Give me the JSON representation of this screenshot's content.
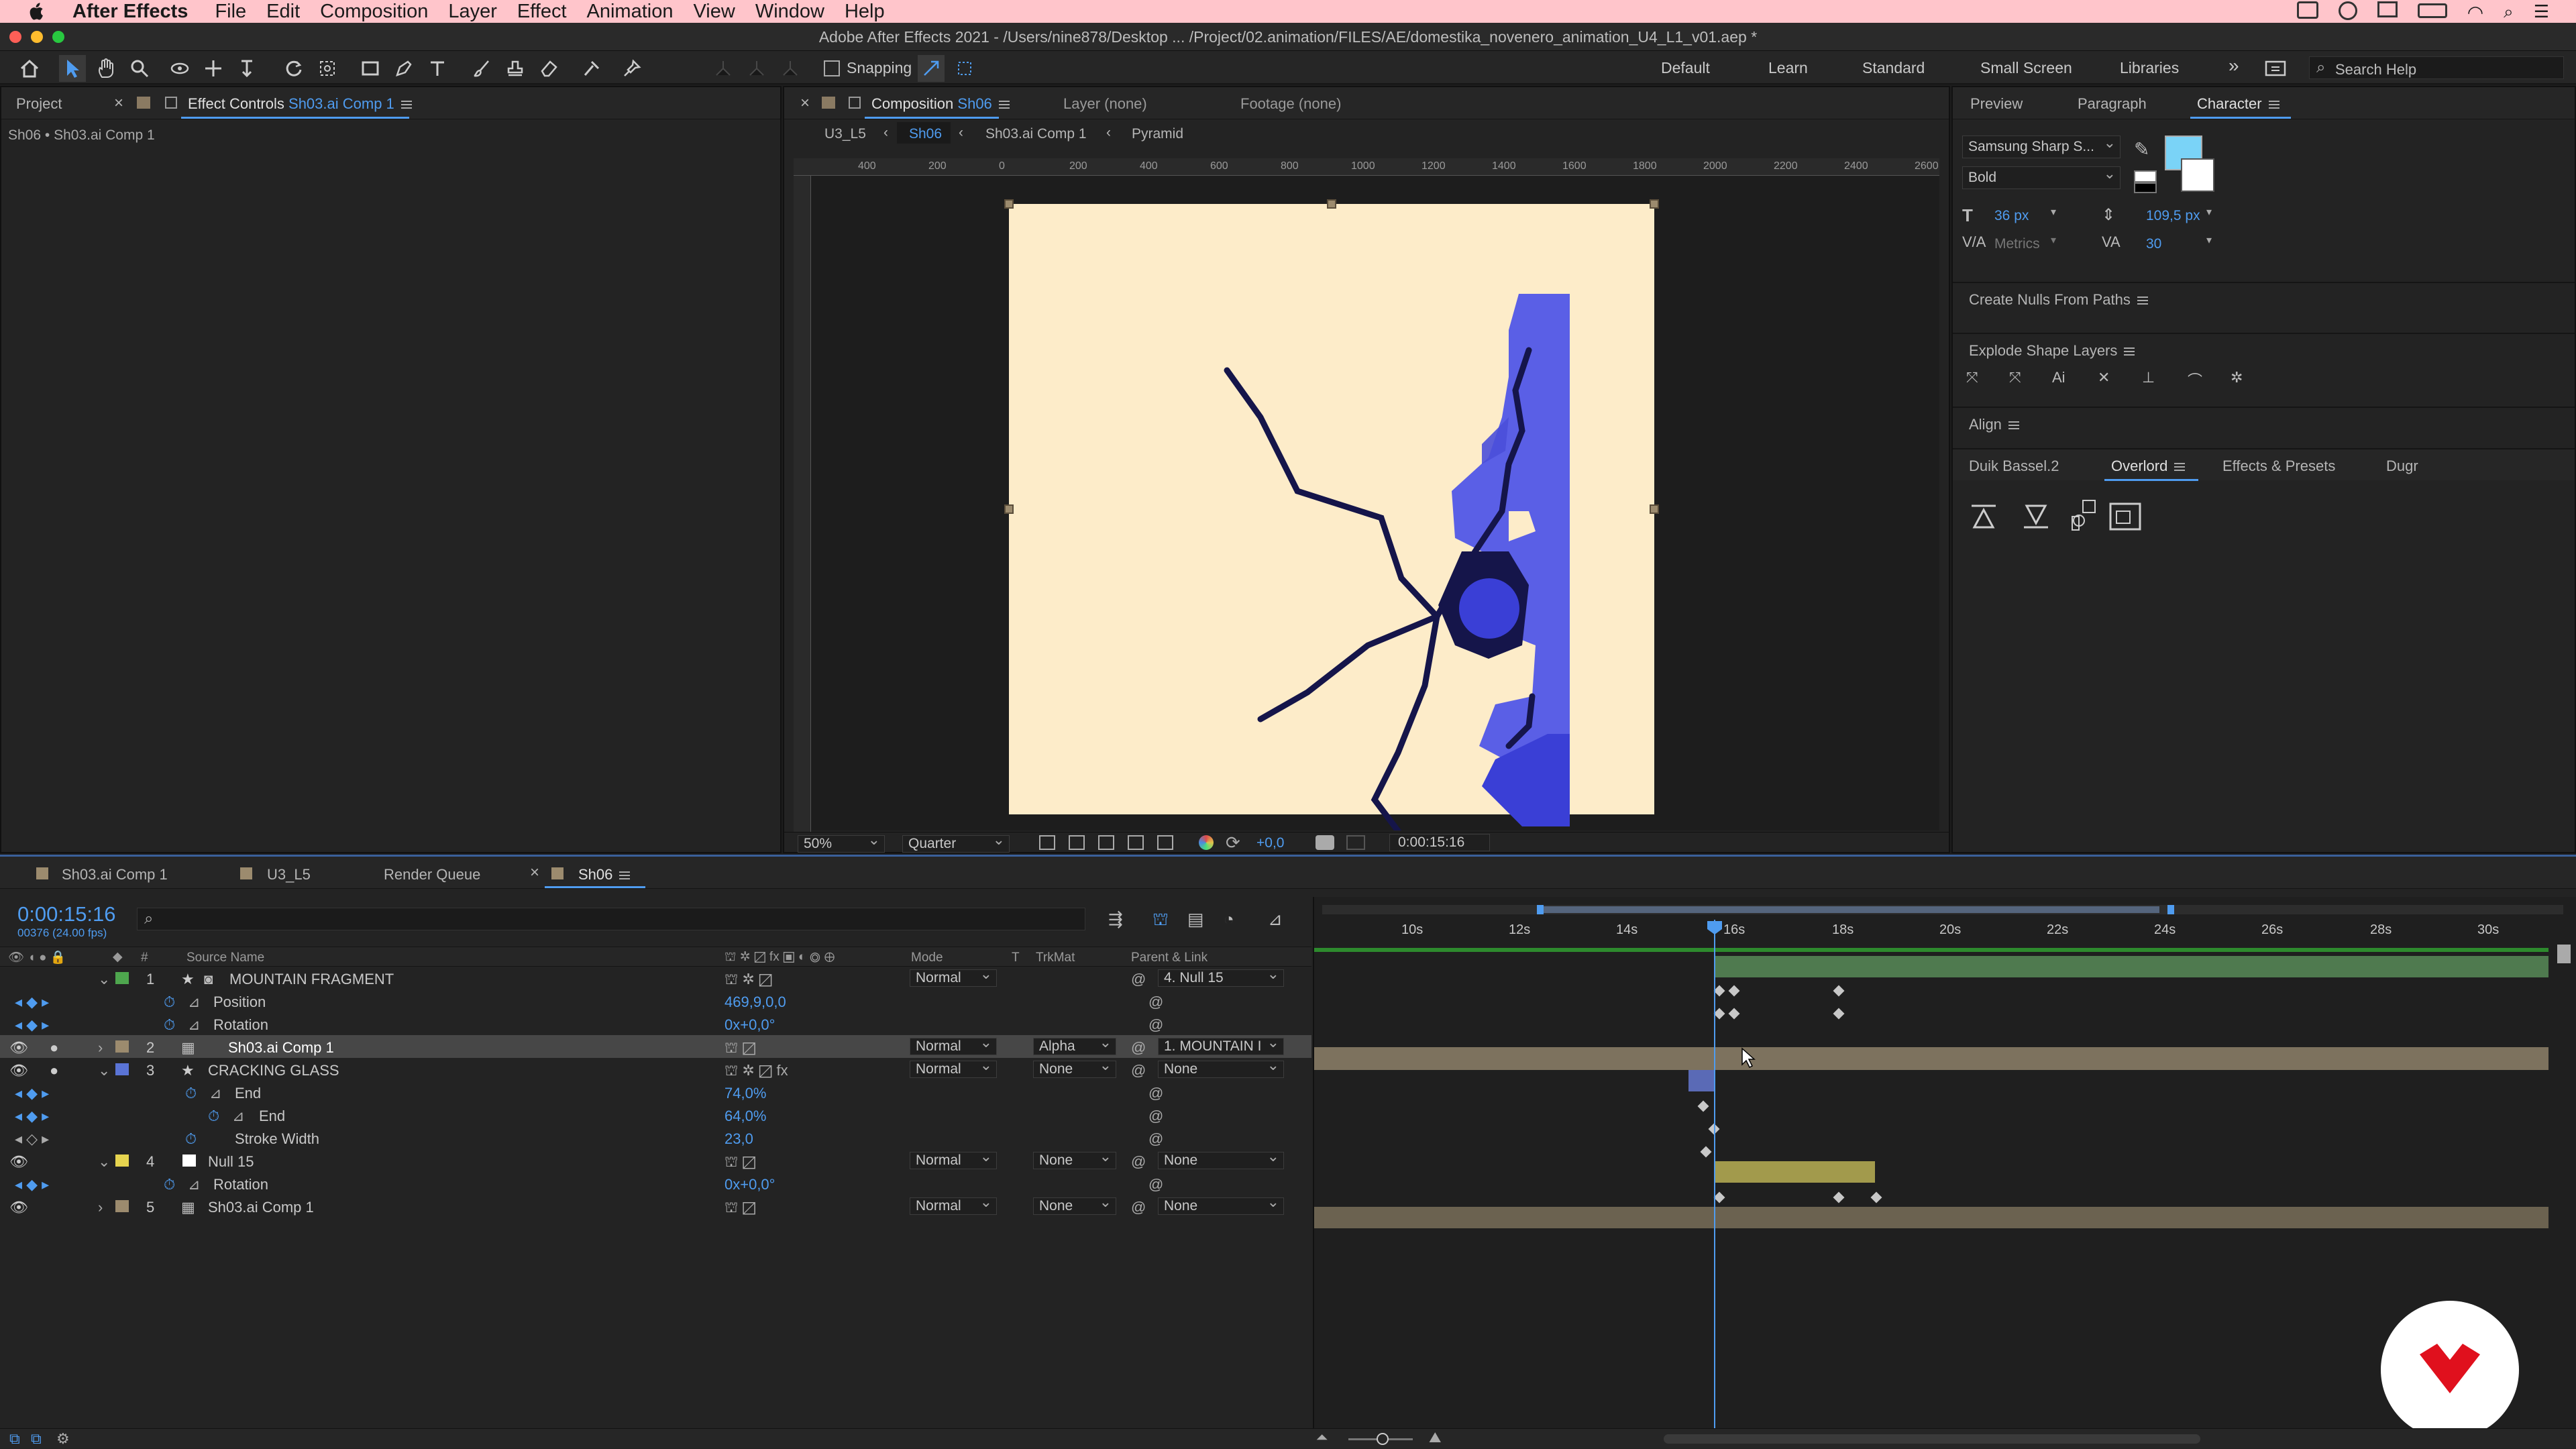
{
  "menubar": {
    "apple": "",
    "app_name": "After Effects",
    "menus": [
      "File",
      "Edit",
      "Composition",
      "Layer",
      "Effect",
      "Animation",
      "View",
      "Window",
      "Help"
    ]
  },
  "window": {
    "title": "Adobe After Effects 2021 - /Users/nine878/Desktop ... /Project/02.animation/FILES/AE/domestika_novenero_animation_U4_L1_v01.aep *"
  },
  "toolbar": {
    "snapping_label": "Snapping",
    "workspaces": [
      "Default",
      "Learn",
      "Standard",
      "Small Screen",
      "Libraries"
    ],
    "search_placeholder": "Search Help"
  },
  "left_panel": {
    "tab_project": "Project",
    "tab_effect_controls": "Effect Controls",
    "tab_effect_controls_target": "Sh03.ai Comp 1",
    "breadcrumb": "Sh06 • Sh03.ai Comp 1"
  },
  "comp_panel": {
    "tab_label": "Composition",
    "tab_comp_name": "Sh06",
    "tab_layer": "Layer (none)",
    "tab_footage": "Footage (none)",
    "nav": [
      "U3_L5",
      "Sh06",
      "Sh03.ai Comp 1",
      "Pyramid"
    ],
    "ruler_labels": [
      "400",
      "200",
      "0",
      "200",
      "400",
      "600",
      "800",
      "1000",
      "1200",
      "1400",
      "1600",
      "1800",
      "2000",
      "2200",
      "2400",
      "2600"
    ],
    "zoom": "50%",
    "resolution": "Quarter",
    "exposure": "+0,0",
    "timecode": "0:00:15:16"
  },
  "right_panel": {
    "tabs": [
      "Preview",
      "Paragraph",
      "Character"
    ],
    "font_family": "Samsung Sharp S...",
    "font_style": "Bold",
    "font_size": "36 px",
    "leading": "109,5 px",
    "kerning": "Metrics",
    "tracking": "30",
    "fill_color": "#7ad3f7",
    "scripts": [
      "Create Nulls From Paths",
      "Explode Shape Layers",
      "Align"
    ],
    "bottom_tabs": [
      "Duik Bassel.2",
      "Overlord",
      "Effects & Presets",
      "Dugr"
    ]
  },
  "timeline": {
    "tabs": [
      "Sh03.ai Comp 1",
      "U3_L5",
      "Render Queue",
      "Sh06"
    ],
    "timecode": "0:00:15:16",
    "frame_info": "00376 (24.00 fps)",
    "column_headers": {
      "num": "#",
      "source": "Source Name",
      "mode": "Mode",
      "t": "T",
      "trkmat": "TrkMat",
      "parent": "Parent & Link"
    },
    "ruler": [
      "10s",
      "12s",
      "14s",
      "16s",
      "18s",
      "20s",
      "22s",
      "24s",
      "26s",
      "28s",
      "30s"
    ],
    "layers": [
      {
        "num": "1",
        "name": "MOUNTAIN FRAGMENT",
        "color": "#4ea64e",
        "mode": "Normal",
        "trkmat": "",
        "parent": "4. Null 15"
      },
      {
        "num": "2",
        "name": "Sh03.ai Comp 1",
        "color": "#9c8b6e",
        "mode": "Normal",
        "trkmat": "Alpha",
        "parent": "1. MOUNTAIN I"
      },
      {
        "num": "3",
        "name": "CRACKING GLASS",
        "color": "#5a74d6",
        "mode": "Normal",
        "trkmat": "None",
        "parent": "None"
      },
      {
        "num": "4",
        "name": "Null 15",
        "color": "#e6d44f",
        "mode": "Normal",
        "trkmat": "None",
        "parent": "None"
      },
      {
        "num": "5",
        "name": "Sh03.ai Comp 1",
        "color": "#9c8b6e",
        "mode": "Normal",
        "trkmat": "None",
        "parent": "None"
      }
    ],
    "props": {
      "position_label": "Position",
      "position_value": "469,9,0,0",
      "rotation_label": "Rotation",
      "rotation_value": "0x+0,0°",
      "end_label": "End",
      "end_value": "74,0%",
      "end2_label": "End",
      "end2_value": "64,0%",
      "stroke_label": "Stroke Width",
      "stroke_value": "23,0",
      "rotation2_label": "Rotation",
      "rotation2_value": "0x+0,0°"
    }
  },
  "colors": {
    "canvas": "#fdecc9",
    "crack": "#15154a",
    "blue_main": "#5a5fe6",
    "blue_dark": "#3a3fd6",
    "accent": "#4f9cf0",
    "badge_red": "#e0101d"
  }
}
